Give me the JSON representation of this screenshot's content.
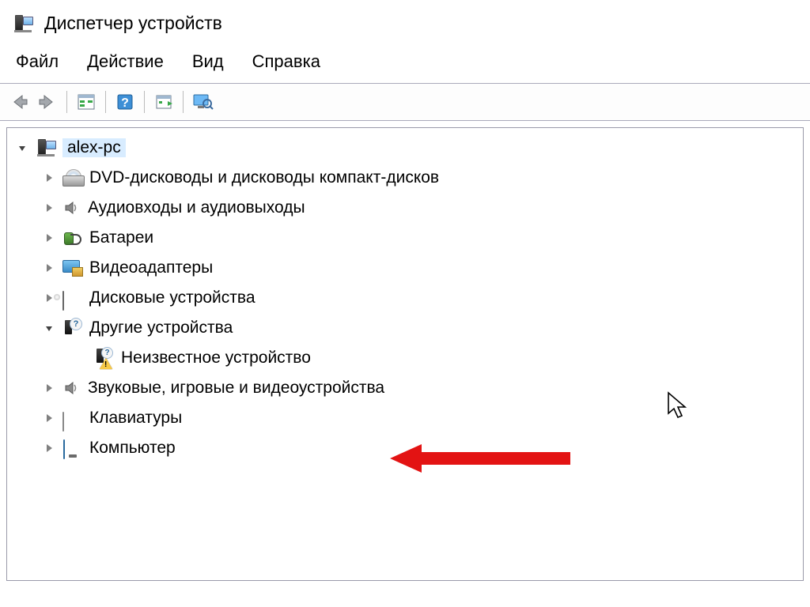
{
  "window": {
    "title": "Диспетчер устройств"
  },
  "menu": {
    "file": "Файл",
    "action": "Действие",
    "view": "Вид",
    "help": "Справка"
  },
  "tree": {
    "root": "alex-pc",
    "dvd": "DVD-дисководы и дисководы компакт-дисков",
    "audio_io": "Аудиовходы и аудиовыходы",
    "batteries": "Батареи",
    "video_adapters": "Видеоадаптеры",
    "disk_drives": "Дисковые устройства",
    "other_devices": "Другие устройства",
    "unknown_device": "Неизвестное устройство",
    "sound_game_video": "Звуковые, игровые и видеоустройства",
    "keyboards": "Клавиатуры",
    "computer": "Компьютер"
  }
}
